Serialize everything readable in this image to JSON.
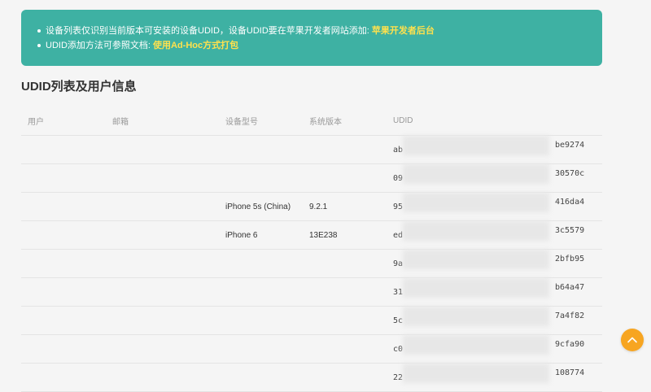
{
  "notice": {
    "line1_text": "设备列表仅识别当前版本可安装的设备UDID，设备UDID要在苹果开发者网站添加: ",
    "line1_link": "苹果开发者后台",
    "line2_text": "UDID添加方法可参照文档: ",
    "line2_link": "使用Ad-Hoc方式打包"
  },
  "section_title": "UDID列表及用户信息",
  "table": {
    "headers": {
      "user": "用户",
      "email": "邮箱",
      "model": "设备型号",
      "os": "系统版本",
      "udid": "UDID"
    },
    "rows": [
      {
        "user": "",
        "email": "",
        "model": "",
        "os": "",
        "udid_start": "ab",
        "udid_end": "be9274"
      },
      {
        "user": "",
        "email": "",
        "model": "",
        "os": "",
        "udid_start": "09",
        "udid_end": "30570c"
      },
      {
        "user": "",
        "email": "",
        "model": "iPhone 5s (China)",
        "os": "9.2.1",
        "udid_start": "95",
        "udid_end": "416da4"
      },
      {
        "user": "",
        "email": "",
        "model": "iPhone 6",
        "os": "13E238",
        "udid_start": "ed",
        "udid_end": "3c5579"
      },
      {
        "user": "",
        "email": "",
        "model": "",
        "os": "",
        "udid_start": "9a",
        "udid_end": "2bfb95"
      },
      {
        "user": "",
        "email": "",
        "model": "",
        "os": "",
        "udid_start": "31",
        "udid_end": "b64a47"
      },
      {
        "user": "",
        "email": "",
        "model": "",
        "os": "",
        "udid_start": "5c",
        "udid_end": "7a4f82"
      },
      {
        "user": "",
        "email": "",
        "model": "",
        "os": "",
        "udid_start": "c0",
        "udid_end": "9cfa90"
      },
      {
        "user": "",
        "email": "",
        "model": "",
        "os": "",
        "udid_start": "22",
        "udid_end": "108774"
      }
    ]
  },
  "scroll_top_icon": "chevron-up-icon",
  "colors": {
    "notice_bg": "#3eb1a3",
    "link": "#ffe14d",
    "scroll_top": "#f7a521"
  }
}
